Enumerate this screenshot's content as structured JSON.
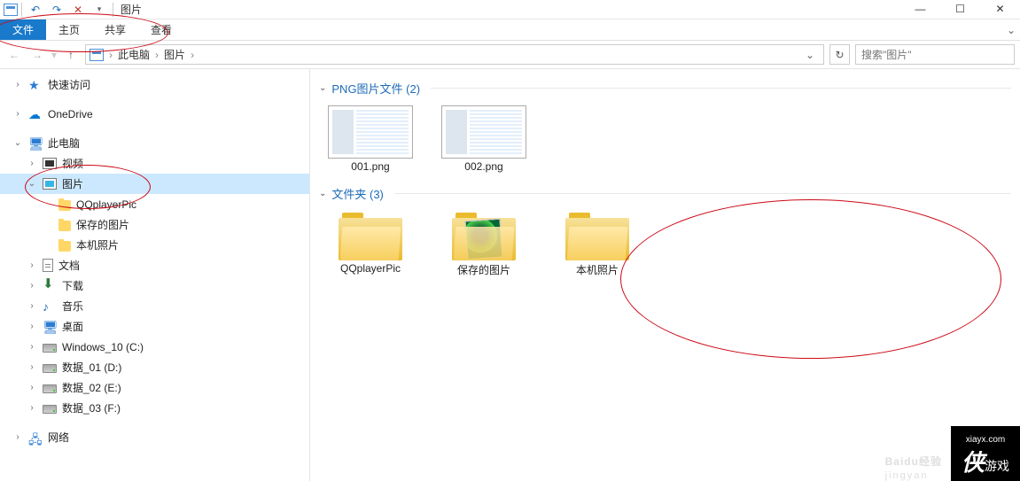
{
  "title": "图片",
  "tabs": {
    "file": "文件",
    "home": "主页",
    "share": "共享",
    "view": "查看"
  },
  "breadcrumb": {
    "root": "此电脑",
    "current": "图片"
  },
  "search": {
    "placeholder": "搜索\"图片\""
  },
  "nav": {
    "quick_access": "快速访问",
    "onedrive": "OneDrive",
    "this_pc": "此电脑",
    "videos": "视频",
    "pictures": "图片",
    "sub1": "QQplayerPic",
    "sub2": "保存的图片",
    "sub3": "本机照片",
    "documents": "文档",
    "downloads": "下载",
    "music": "音乐",
    "desktop": "桌面",
    "drive_c": "Windows_10 (C:)",
    "drive_d": "数据_01 (D:)",
    "drive_e": "数据_02 (E:)",
    "drive_f": "数据_03 (F:)",
    "network": "网络"
  },
  "groups": {
    "png": {
      "label": "PNG图片文件 (2)",
      "items": [
        "001.png",
        "002.png"
      ]
    },
    "folders": {
      "label": "文件夹 (3)",
      "items": [
        "QQplayerPic",
        "保存的图片",
        "本机照片"
      ]
    }
  },
  "watermark": {
    "brand": "Baidu",
    "brand_sub": "经验",
    "brand_url": "jingyan",
    "logo_big": "侠",
    "logo_text": "游戏",
    "logo_url": "xiayx.com"
  }
}
